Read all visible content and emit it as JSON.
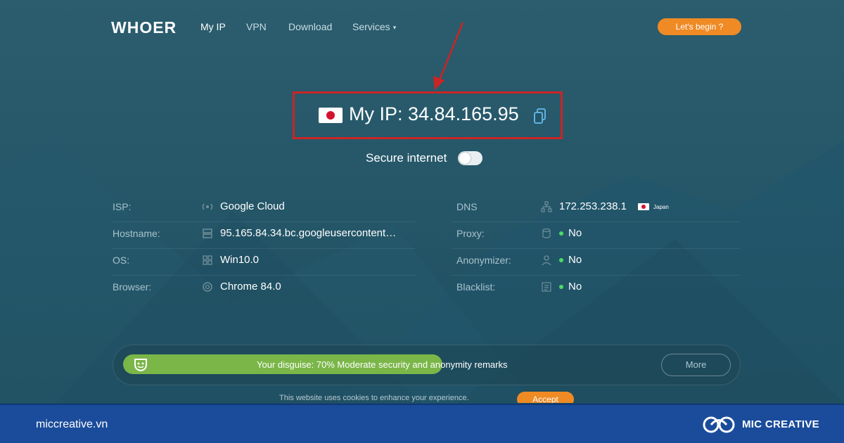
{
  "nav": {
    "logo": "WHOER",
    "links": [
      {
        "label": "My IP",
        "active": true
      },
      {
        "label": "VPN",
        "active": false
      },
      {
        "label": "Download",
        "active": false
      },
      {
        "label": "Services",
        "active": false
      }
    ],
    "services_caret": "▾",
    "cta_label": "Let's begin ?"
  },
  "ip": {
    "flag_icon": "japan-flag-icon",
    "label": "My IP: 34.84.165.95",
    "copy_icon": "copy-icon"
  },
  "secure": {
    "label": "Secure internet",
    "enabled": false
  },
  "info_left": [
    {
      "label": "ISP:",
      "value": "Google Cloud",
      "icon": "wifi-icon"
    },
    {
      "label": "Hostname:",
      "value": "95.165.84.34.bc.googleusercontent…",
      "icon": "server-icon"
    },
    {
      "label": "OS:",
      "value": "Win10.0",
      "icon": "windows-icon"
    },
    {
      "label": "Browser:",
      "value": "Chrome 84.0",
      "icon": "chrome-icon"
    }
  ],
  "info_right": [
    {
      "label": "DNS",
      "value": "172.253.238.1",
      "country": "Japan",
      "icon": "network-icon"
    },
    {
      "label": "Proxy:",
      "value": "No",
      "icon": "database-icon"
    },
    {
      "label": "Anonymizer:",
      "value": "No",
      "icon": "user-icon"
    },
    {
      "label": "Blacklist:",
      "value": "No",
      "icon": "list-icon"
    }
  ],
  "disguise": {
    "percent": 70,
    "text": "Your disguise: 70% Moderate security and anonymity remarks",
    "more_label": "More",
    "bar_color": "#7ab648"
  },
  "cookie": {
    "text": "This website uses cookies to enhance your experience.",
    "accept_label": "Accept"
  },
  "footer": {
    "site": "miccreative.vn",
    "brand": "MIC CREATIVE"
  },
  "colors": {
    "accent": "#f08a24",
    "annotation": "#cc2424",
    "footer": "#1b4c9b"
  }
}
